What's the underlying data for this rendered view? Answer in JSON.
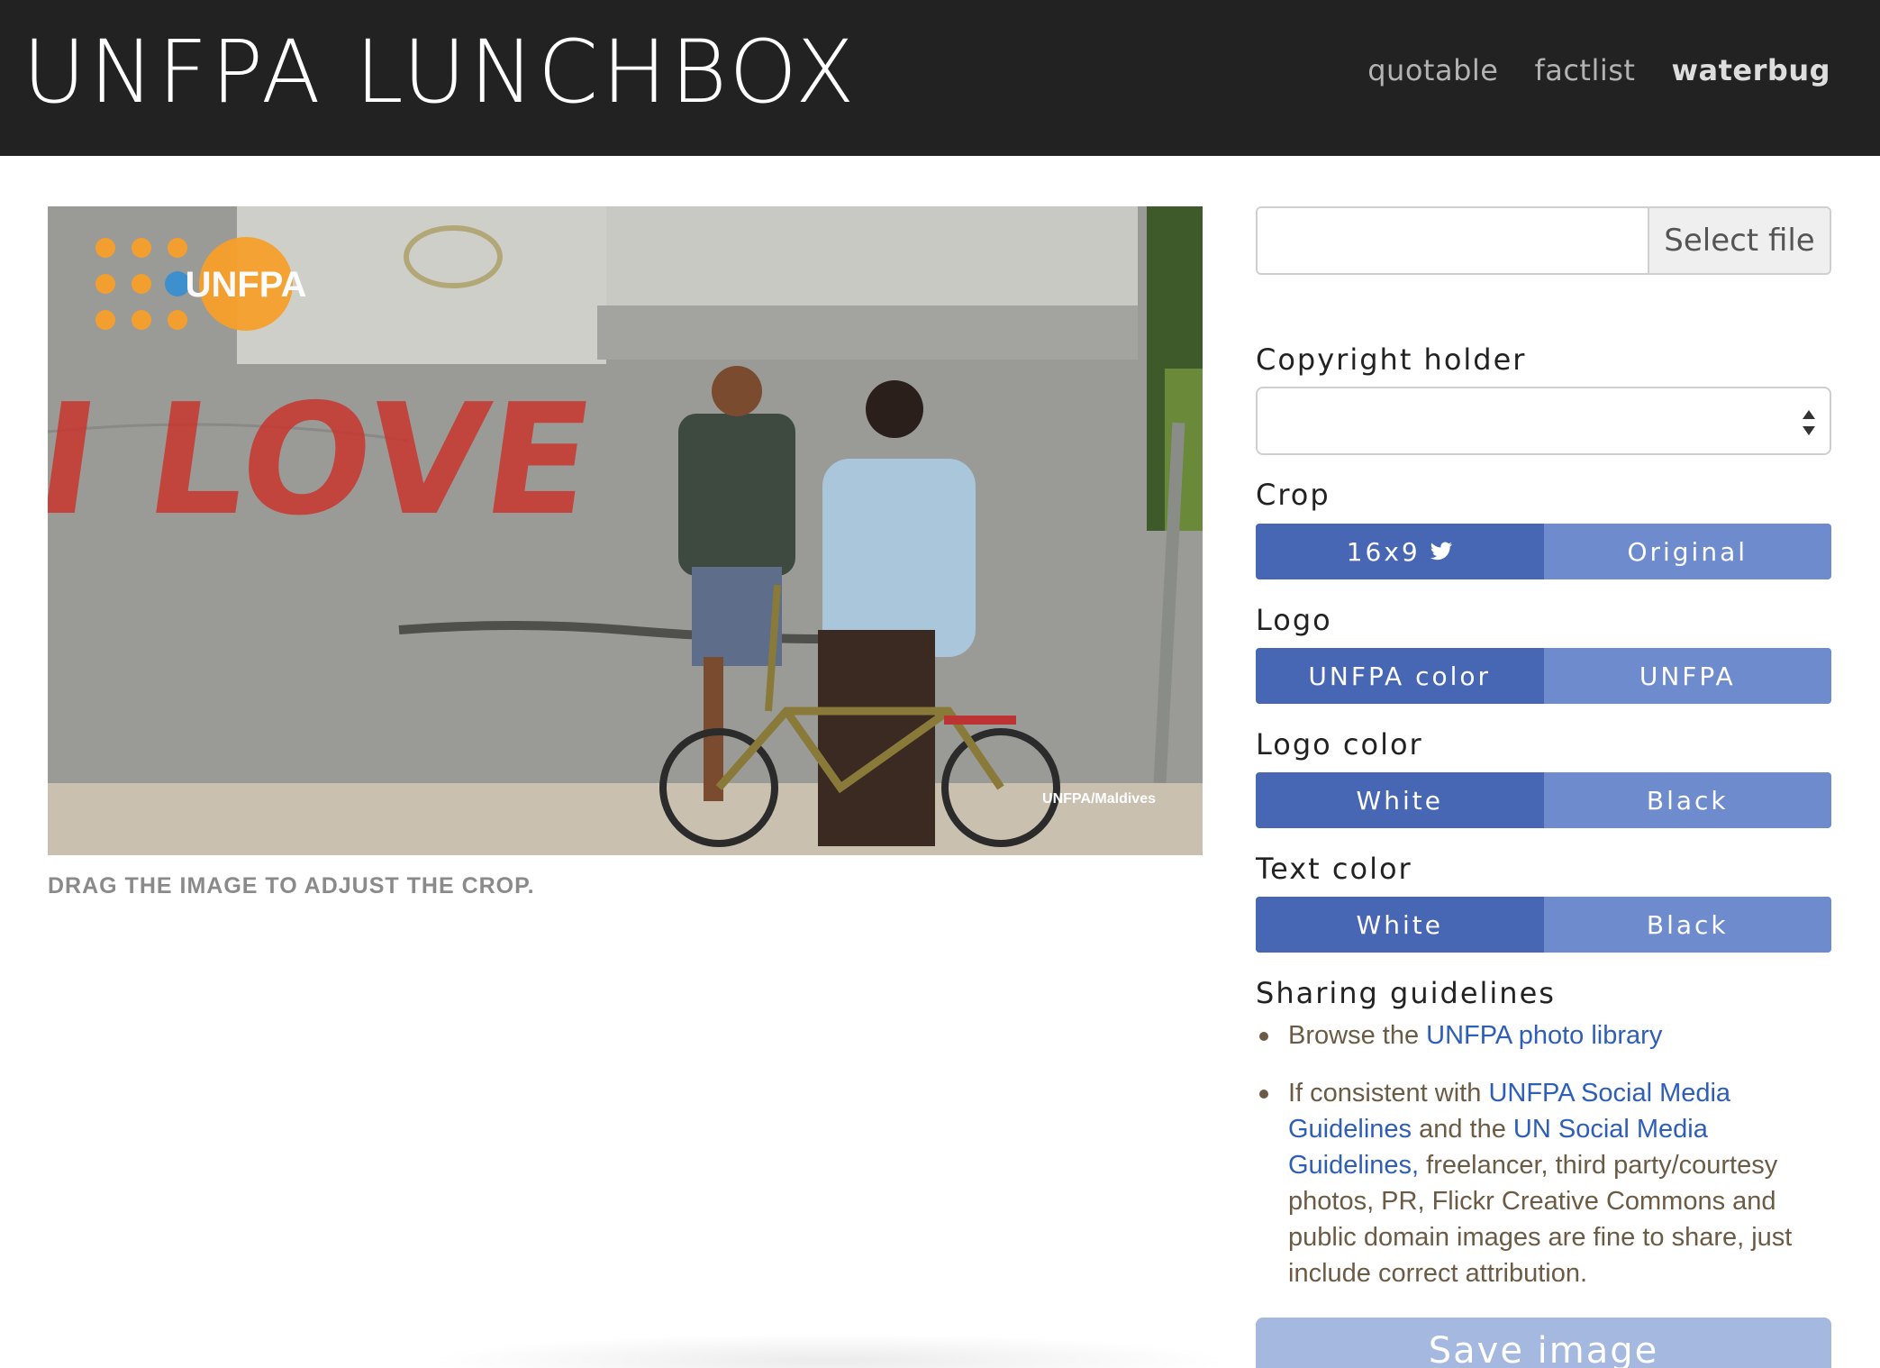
{
  "header": {
    "brand": "UNFPA LUNCHBOX",
    "nav": [
      "quotable",
      "factlist",
      "waterbug"
    ],
    "active_nav": "waterbug"
  },
  "photo": {
    "graffiti_text": "I LOVE",
    "logo_text": "UNFPA",
    "credit": "UNFPA/Maldives",
    "hint": "DRAG THE IMAGE TO ADJUST THE CROP."
  },
  "panel": {
    "file_button": "Select file",
    "file_value": "",
    "copyright_label": "Copyright holder",
    "copyright_value": "",
    "crop_label": "Crop",
    "crop_options": [
      "16x9",
      "Original"
    ],
    "crop_selected": "16x9",
    "crop_icon": "twitter-bird-icon",
    "logo_label": "Logo",
    "logo_options": [
      "UNFPA color",
      "UNFPA"
    ],
    "logo_selected": "UNFPA color",
    "logo_color_label": "Logo color",
    "logo_color_options": [
      "White",
      "Black"
    ],
    "logo_color_selected": "White",
    "text_color_label": "Text color",
    "text_color_options": [
      "White",
      "Black"
    ],
    "text_color_selected": "White",
    "sharing_label": "Sharing guidelines",
    "guide1_prefix": "Browse the ",
    "guide1_link": "UNFPA photo library",
    "guide2_prefix": "If consistent with ",
    "guide2_link1": "UNFPA Social Media Guidelines",
    "guide2_mid": " and the ",
    "guide2_link2": "UN Social Media Guidelines,",
    "guide2_suffix": " freelancer, third party/courtesy photos, PR, Flickr Creative Commons and public domain images are fine to share, just include correct attribution.",
    "save_button": "Save image"
  },
  "colors": {
    "header_bg": "#222222",
    "button_selected": "#4767b5",
    "button_unselected": "#6e8ccd",
    "link": "#2e5eb8",
    "unfpa_orange": "#f7a02b"
  }
}
